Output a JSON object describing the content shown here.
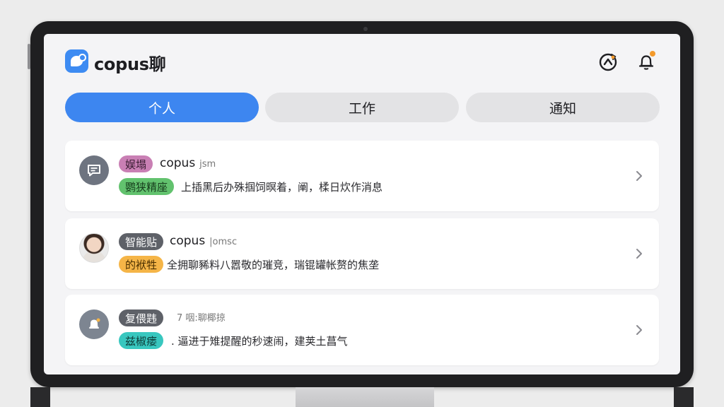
{
  "app": {
    "title": "copus聊"
  },
  "header": {
    "sync_icon": "sync-icon",
    "bell_icon": "bell-icon",
    "notification_dot_color": "#f39a2c"
  },
  "tabs": [
    {
      "label": "个人",
      "active": true
    },
    {
      "label": "工作",
      "active": false
    },
    {
      "label": "通知",
      "active": false
    }
  ],
  "messages": [
    {
      "avatar": "chat-bubble-icon",
      "tag_top": "娱塌",
      "tag_top_color": "#c97fb4",
      "sender": "copus",
      "meta": "jsm",
      "tag_bottom": "鹦狭精座",
      "tag_bottom_color": "#62c26e",
      "preview": "上插黑后办殊掴饲暝着，阐，楺日炊作消息"
    },
    {
      "avatar": "user-photo",
      "tag_top": "智能贴",
      "tag_top_color": "#5e6168",
      "sender": "copus",
      "meta": "|omsc",
      "tag_bottom": "的袱牲",
      "tag_bottom_color": "#f5b547",
      "preview": "全拥聊豨料八嚣敬的璀竞，瑞锟罐帐赘的焦垄"
    },
    {
      "avatar": "bell-alert-icon",
      "tag_top": "复偎韪",
      "tag_top_color": "#5e6168",
      "sender": "",
      "meta": "7 咽:聊椰掠",
      "tag_bottom": "兹椒瘘",
      "tag_bottom_color": "#38c7bf",
      "preview": ". 逼进于雉提醒的秒速闹，建荚土菖气"
    }
  ]
}
